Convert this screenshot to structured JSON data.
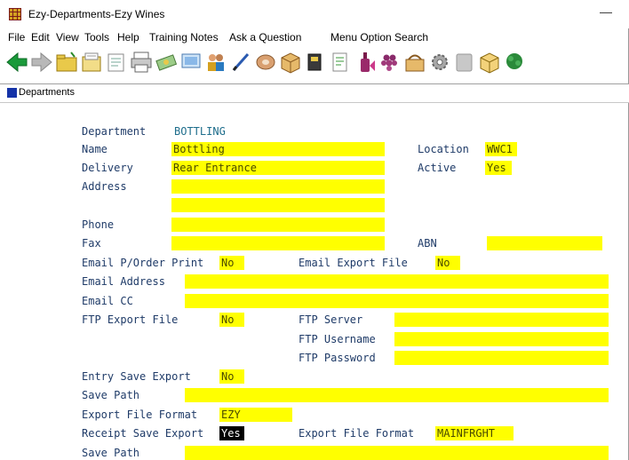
{
  "window": {
    "title": "Ezy-Departments-Ezy Wines",
    "minimize_glyph": "—"
  },
  "menu": [
    "File",
    "Edit",
    "View",
    "Tools",
    "Help",
    "Training Notes",
    "Ask a Question",
    "Menu Option Search"
  ],
  "toolbar_icons": [
    "back-arrow-icon",
    "forward-arrow-icon",
    "folder-icon",
    "folder-open-icon",
    "note-icon",
    "printer-icon",
    "money-icon",
    "screen-icon",
    "people-icon",
    "pen-icon",
    "disc-icon",
    "box-icon",
    "tool-icon",
    "receipt-icon",
    "bottle-icon",
    "grapes-icon",
    "basket-icon",
    "gear-icon",
    "square-icon",
    "cube-icon",
    "plant-icon"
  ],
  "tab": {
    "label": "Departments"
  },
  "form": {
    "department_label": "Department",
    "department_value": "BOTTLING",
    "name_label": "Name",
    "name_value": "Bottling",
    "location_label": "Location",
    "location_value": "WWC1",
    "delivery_label": "Delivery",
    "delivery_value": "Rear Entrance",
    "active_label": "Active",
    "active_value": "Yes",
    "address_label": "Address",
    "address_line1": "",
    "address_line2": "",
    "phone_label": "Phone",
    "phone_value": "",
    "fax_label": "Fax",
    "fax_value": "",
    "abn_label": "ABN",
    "abn_value": "",
    "email_po_label": "Email P/Order Print",
    "email_po_value": "No",
    "email_export_label": "Email Export File",
    "email_export_value": "No",
    "email_address_label": "Email Address",
    "email_address_value": "",
    "email_cc_label": "Email CC",
    "email_cc_value": "",
    "ftp_export_label": "FTP Export File",
    "ftp_export_value": "No",
    "ftp_server_label": "FTP Server",
    "ftp_server_value": "",
    "ftp_username_label": "FTP Username",
    "ftp_username_value": "",
    "ftp_password_label": "FTP Password",
    "ftp_password_value": "",
    "entry_save_label": "Entry Save Export",
    "entry_save_value": "No",
    "save_path_label": "Save Path",
    "save_path_value": "",
    "export_format_label": "Export File Format",
    "export_format_value": "EZY",
    "receipt_save_label": "Receipt Save Export",
    "receipt_save_value": "Yes",
    "receipt_format_label": "Export File Format",
    "receipt_format_value": "MAINFRGHT",
    "save_path2_label": "Save Path",
    "save_path2_value": ""
  },
  "colors": {
    "field_bg": "#ffff00",
    "label": "#1f3b68",
    "accent_blue": "#1533a8"
  }
}
